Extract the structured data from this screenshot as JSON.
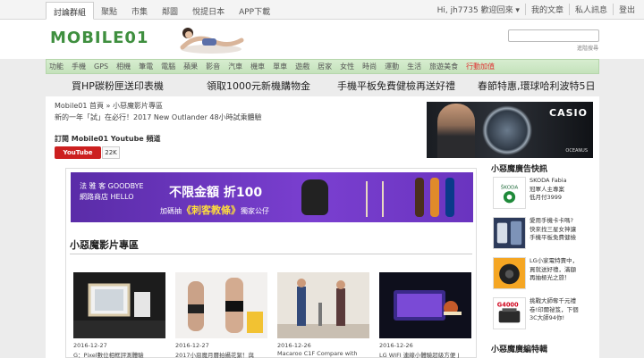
{
  "topnav": {
    "tabs": [
      "討論群組",
      "聚點",
      "市集",
      "鄰圖",
      "悅提日本",
      "APP下載"
    ],
    "active_index": 0
  },
  "user_links": [
    "Hi, jh7735 歡迎回來 ▾",
    "我的文章",
    "私人訊息",
    "登出"
  ],
  "header": {
    "logo_text": "MOBILE01",
    "search_placeholder": "",
    "advanced_search": "進階搜尋"
  },
  "category_nav": [
    "功能",
    "手機",
    "GPS",
    "相機",
    "筆電",
    "電腦",
    "蘋果",
    "影音",
    "汽車",
    "機車",
    "單車",
    "遊戲",
    "居家",
    "女性",
    "時尚",
    "運動",
    "生活",
    "旅遊美食",
    "行動加值"
  ],
  "promos": [
    "買HP碳粉匣送印表機",
    "領取1000元新機購物金",
    "手機平板免費健檢再送好禮",
    "春節特惠,環球哈利波特5日"
  ],
  "breadcrumb": "Mobile01 首頁 » 小惡魔影片專區",
  "subtitle": "新的一年「試」在必行！2017 New Outlander 48小時試乘體驗",
  "youtube": {
    "heading": "訂閱 Mobile01 Youtube 頻道",
    "button_label": "YouTube",
    "count": "22K"
  },
  "casio_ad": {
    "brand": "CASIO",
    "sub": "OCEANUS"
  },
  "banner_ad": {
    "line1": "法 雅 客 GOODBYE",
    "line2": "網路商店 HELLO",
    "headline": "不限金額 折100",
    "offer_prefix": "加碼抽",
    "offer_highlight": "《刺客教條》",
    "offer_suffix": "獨家公仔"
  },
  "section_title": "小惡魔影片專區",
  "videos": [
    {
      "date": "2016-12-27",
      "title": "G：Pixel數位相框評測體驗"
    },
    {
      "date": "2016-12-27",
      "title": "2017小惡魔月曆拍攝花絮！與"
    },
    {
      "date": "2016-12-26",
      "title": "Macaroo C1F Compare with"
    },
    {
      "date": "2016-12-26",
      "title": "LG WIFI 連線小體驗超級方便 J"
    }
  ],
  "sidebar": {
    "ads_title": "小惡魔廣告快訊",
    "ads": [
      {
        "lines": [
          "SKODA Fabia",
          "冠軍人主專案",
          "低月付3999"
        ]
      },
      {
        "lines": [
          "愛用手機卡卡嗎?",
          "快來找三星女神讓",
          "手機平板免費健檢"
        ]
      },
      {
        "lines": [
          "LG小家電特賣中，",
          "買就送好禮，滿額",
          "再抽極光之旅！"
        ]
      },
      {
        "lines": [
          "挑戰大師奪千元禮",
          "卷!印爾祕笈，下個",
          "3C大師94你!"
        ]
      }
    ],
    "editor_title": "小惡魔廣編特輯"
  }
}
